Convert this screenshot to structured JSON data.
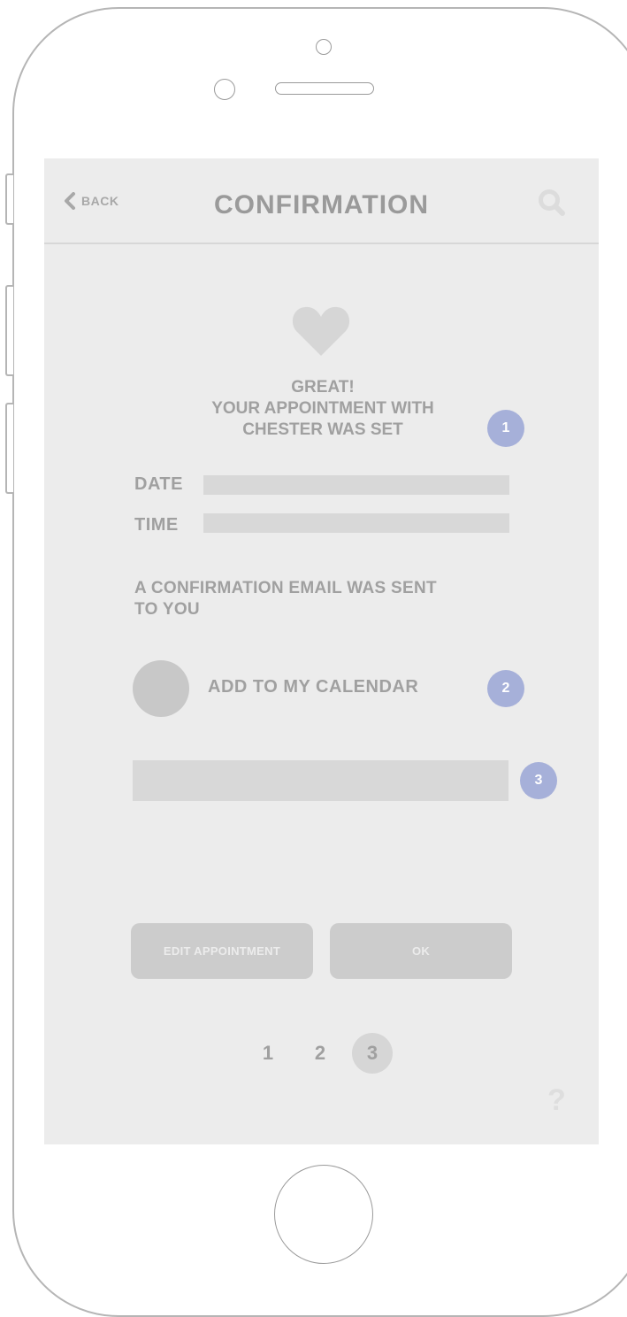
{
  "header": {
    "back_label": "BACK",
    "title": "CONFIRMATION",
    "search_icon": "search-icon",
    "back_icon": "chevron-left-icon"
  },
  "confirmation": {
    "heart_icon": "heart-icon",
    "line1": "GREAT!",
    "line2": "YOUR APPOINTMENT WITH",
    "line3": "CHESTER WAS SET"
  },
  "fields": {
    "date_label": "DATE",
    "time_label": "TIME"
  },
  "email": {
    "line1": "A CONFIRMATION EMAIL WAS SENT",
    "line2": "TO YOU"
  },
  "calendar": {
    "label": "ADD TO MY CALENDAR"
  },
  "badges": {
    "b1": "1",
    "b2": "2",
    "b3": "3"
  },
  "actions": {
    "edit_label": "EDIT APPOINTMENT",
    "ok_label": "OK"
  },
  "pagination": {
    "pages": [
      "1",
      "2",
      "3"
    ],
    "current": "3"
  },
  "help": {
    "label": "?"
  },
  "colors": {
    "screen_bg": "#ececec",
    "badge": "#a6b0d9",
    "text_gray": "#a0a0a0",
    "placeholder_bar": "#d8d8d8",
    "button_bg": "#cccccc"
  }
}
